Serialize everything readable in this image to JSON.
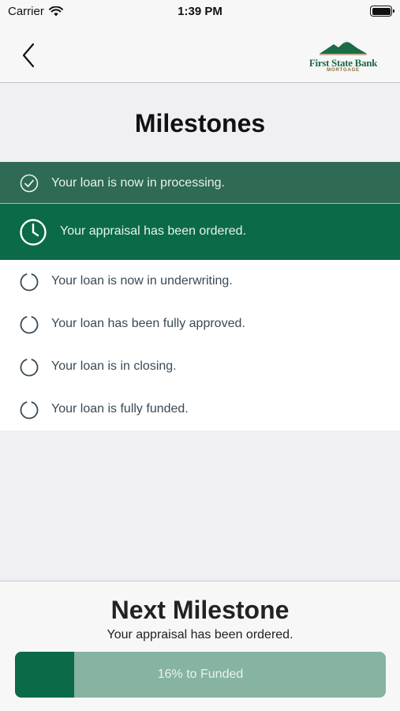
{
  "status_bar": {
    "carrier": "Carrier",
    "time": "1:39 PM"
  },
  "nav": {
    "logo_brand": "First State Bank",
    "logo_sub": "MORTGAGE"
  },
  "title": "Milestones",
  "milestones": [
    {
      "label": "Your loan is now in processing.",
      "state": "complete"
    },
    {
      "label": "Your appraisal has been ordered.",
      "state": "current"
    },
    {
      "label": "Your loan is now in underwriting.",
      "state": "pending"
    },
    {
      "label": "Your loan has been fully approved.",
      "state": "pending"
    },
    {
      "label": "Your loan is in closing.",
      "state": "pending"
    },
    {
      "label": "Your loan is fully funded.",
      "state": "pending"
    }
  ],
  "next": {
    "title": "Next Milestone",
    "subtitle": "Your appraisal has been ordered.",
    "progress_text": "16% to Funded",
    "progress_fraction": 0.16
  },
  "colors": {
    "brand_green": "#0b6a47",
    "complete_green": "#2e6a54",
    "progress_track": "#87b3a1"
  }
}
